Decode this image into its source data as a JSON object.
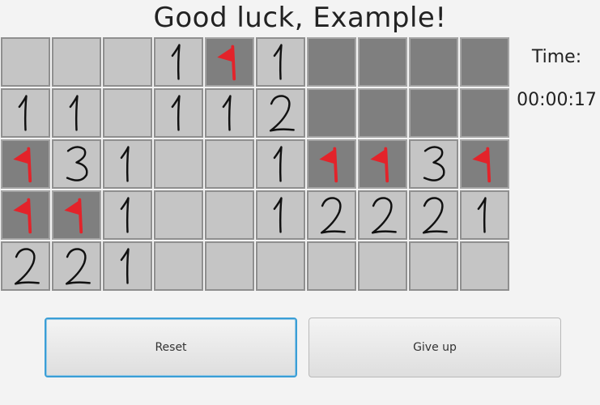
{
  "title": "Good luck, Example!",
  "timer": {
    "label": "Time:",
    "value": "00:00:17"
  },
  "buttons": {
    "reset": "Reset",
    "give_up": "Give up"
  },
  "colors": {
    "flag": "#e3232a",
    "revealed": "#c5c5c5",
    "hidden": "#7f7f7f",
    "digit": "#111111"
  },
  "board": [
    [
      "R",
      "R",
      "R",
      "1",
      "F",
      "1",
      "H",
      "H",
      "H",
      "H"
    ],
    [
      "1",
      "1",
      "R",
      "1",
      "1",
      "2",
      "H",
      "H",
      "H",
      "H"
    ],
    [
      "F",
      "3",
      "1",
      "R",
      "R",
      "1",
      "F",
      "F",
      "3",
      "F"
    ],
    [
      "F",
      "F",
      "1",
      "R",
      "R",
      "1",
      "2",
      "2",
      "2",
      "1"
    ],
    [
      "2",
      "2",
      "1",
      "R",
      "R",
      "R",
      "R",
      "R",
      "R",
      "R"
    ]
  ]
}
